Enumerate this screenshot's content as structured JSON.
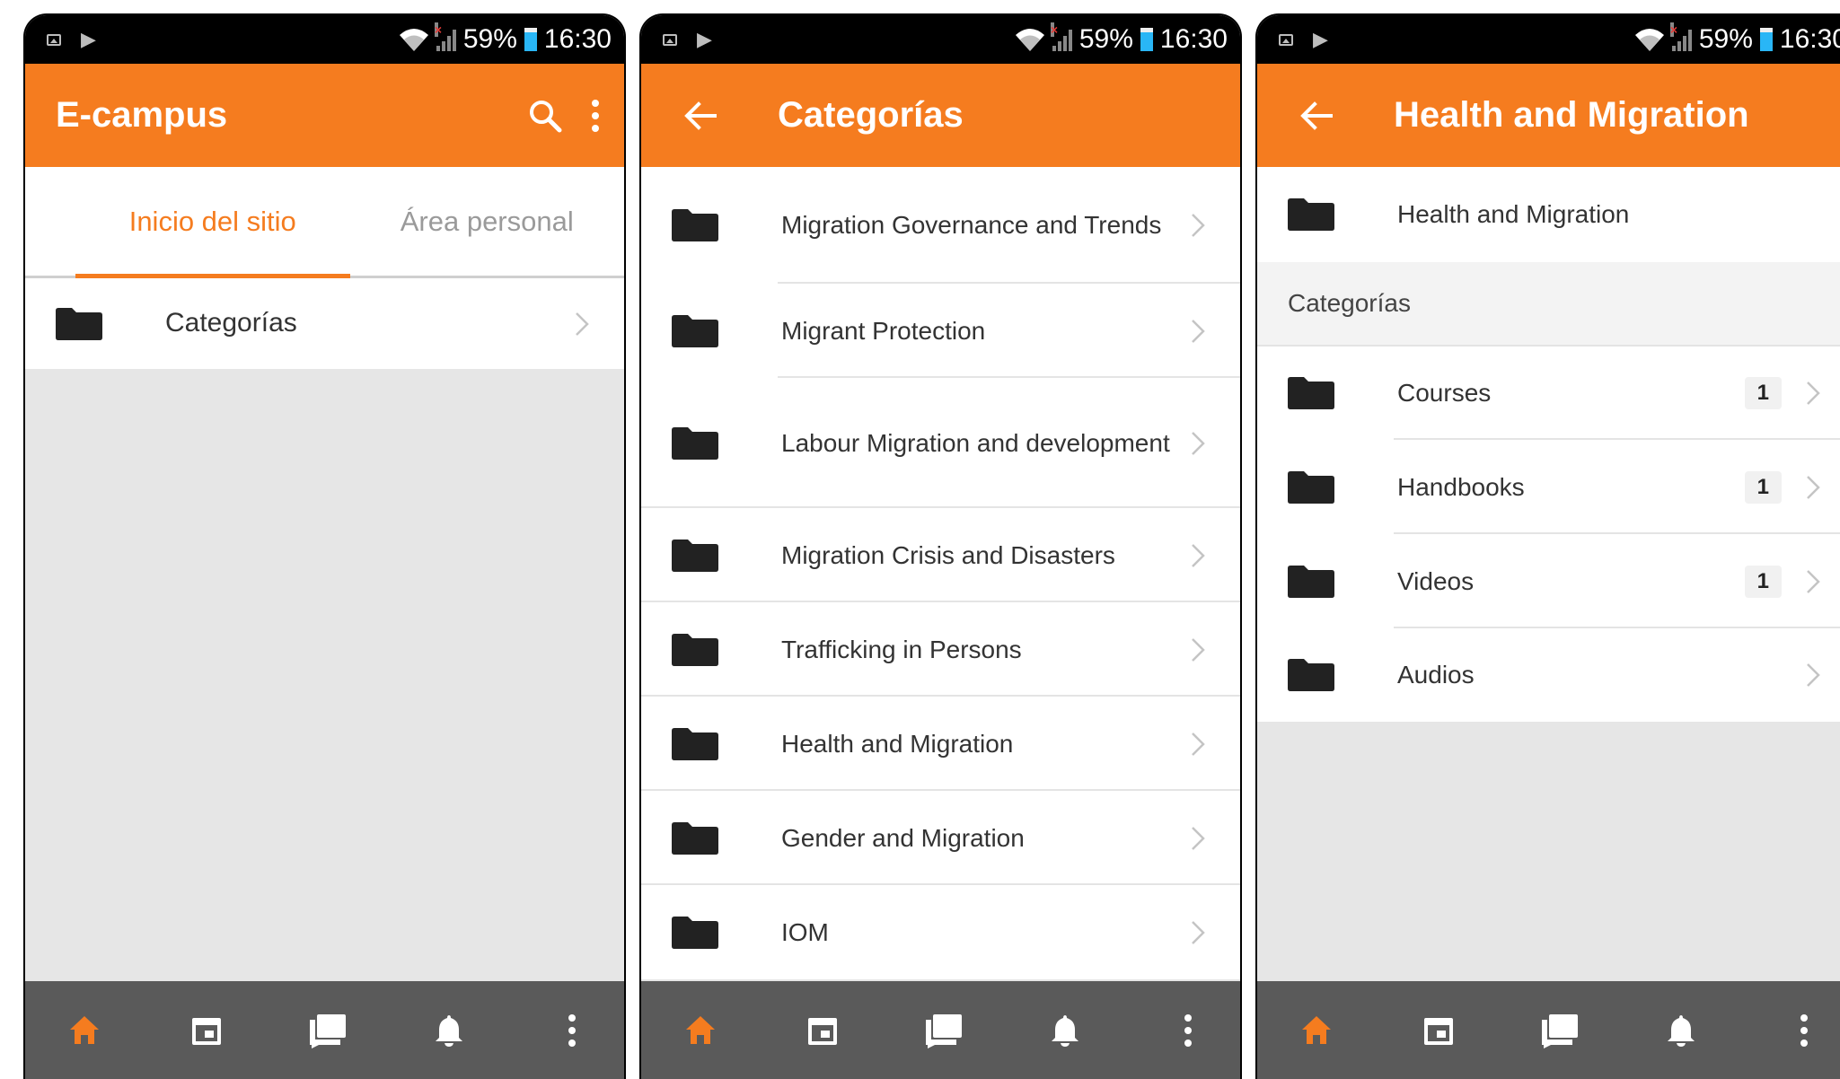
{
  "status_bar": {
    "battery": "59%",
    "time": "16:30"
  },
  "colors": {
    "accent": "#f57c1f",
    "nav_bg": "#5a5a5a",
    "status_bg": "#000000"
  },
  "screen1": {
    "title": "E-campus",
    "tabs": [
      "Inicio del sitio",
      "Área personal"
    ],
    "items": [
      {
        "label": "Categorías"
      }
    ]
  },
  "screen2": {
    "title": "Categorías",
    "items": [
      {
        "label": "Migration Governance and Trends"
      },
      {
        "label": "Migrant Protection"
      },
      {
        "label": "Labour Migration and development"
      },
      {
        "label": "Migration Crisis and Disasters"
      },
      {
        "label": "Trafficking in Persons"
      },
      {
        "label": "Health and Migration"
      },
      {
        "label": "Gender and Migration"
      },
      {
        "label": "IOM"
      }
    ]
  },
  "screen3": {
    "title": "Health and Migration",
    "parent_item": {
      "label": "Health and Migration"
    },
    "section_header": "Categorías",
    "items": [
      {
        "label": "Courses",
        "count": "1"
      },
      {
        "label": "Handbooks",
        "count": "1"
      },
      {
        "label": "Videos",
        "count": "1"
      },
      {
        "label": "Audios"
      }
    ]
  },
  "bottom_nav_icons": [
    "home-icon",
    "calendar-icon",
    "messages-icon",
    "notifications-icon",
    "more-icon"
  ]
}
